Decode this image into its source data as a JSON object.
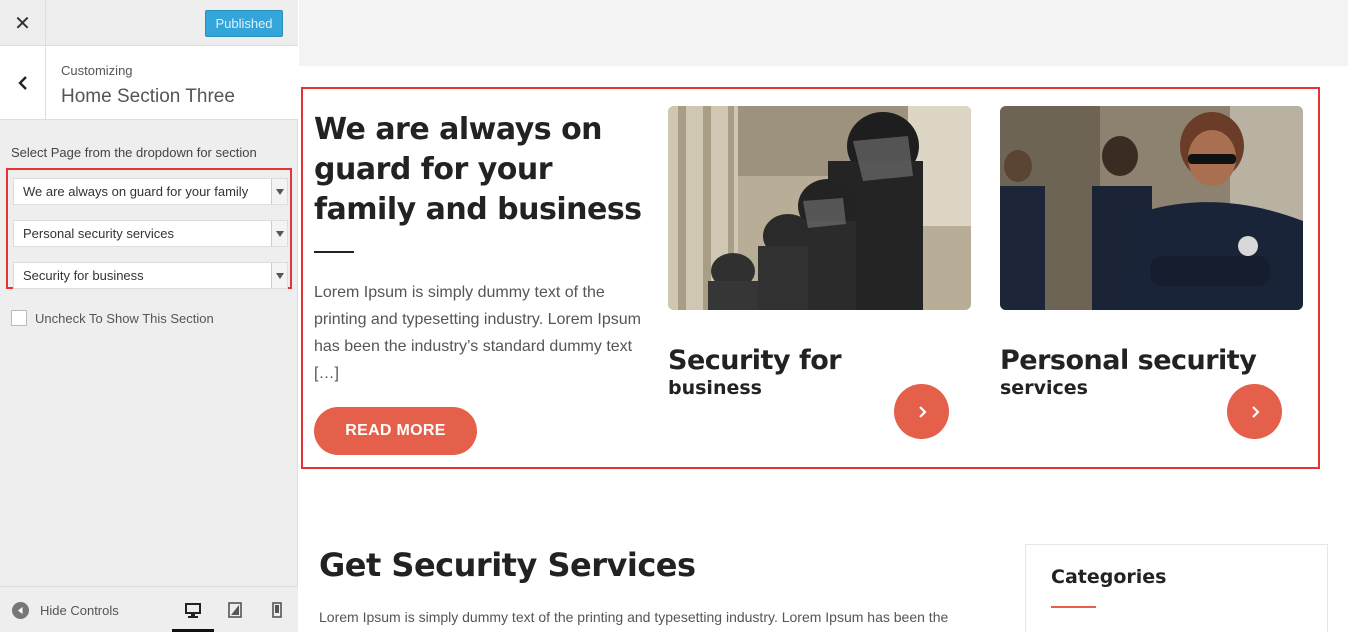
{
  "sidebar": {
    "close_glyph": "✕",
    "publish_label": "Published",
    "breadcrumb_small": "Customizing",
    "section_title": "Home Section Three",
    "select_label": "Select Page from the dropdown for section",
    "selects": [
      {
        "value": "We are always on guard for your family"
      },
      {
        "value": "Personal security services"
      },
      {
        "value": "Security for business"
      }
    ],
    "checkbox_label": "Uncheck To Show This Section",
    "hide_controls_label": "Hide Controls",
    "devices": [
      "desktop-icon",
      "tablet-icon",
      "mobile-icon"
    ]
  },
  "preview": {
    "hero": {
      "title": "We are always on guard for your family and business",
      "text": "Lorem Ipsum is simply dummy text of the printing and typesetting industry. Lorem Ipsum has been the industry’s standard dummy text […]",
      "button_label": "READ MORE"
    },
    "cards": [
      {
        "title": "Security for",
        "subtitle": "business",
        "image": "riot-police-image"
      },
      {
        "title": "Personal security",
        "subtitle": "services",
        "image": "police-officer-image"
      }
    ],
    "services": {
      "title": "Get Security Services",
      "text": "Lorem Ipsum is simply dummy text of the printing and typesetting industry. Lorem Ipsum has been the"
    },
    "categories_title": "Categories"
  },
  "colors": {
    "accent": "#e4604b",
    "highlight_border": "#e33535",
    "publish_button": "#33a5d8"
  }
}
